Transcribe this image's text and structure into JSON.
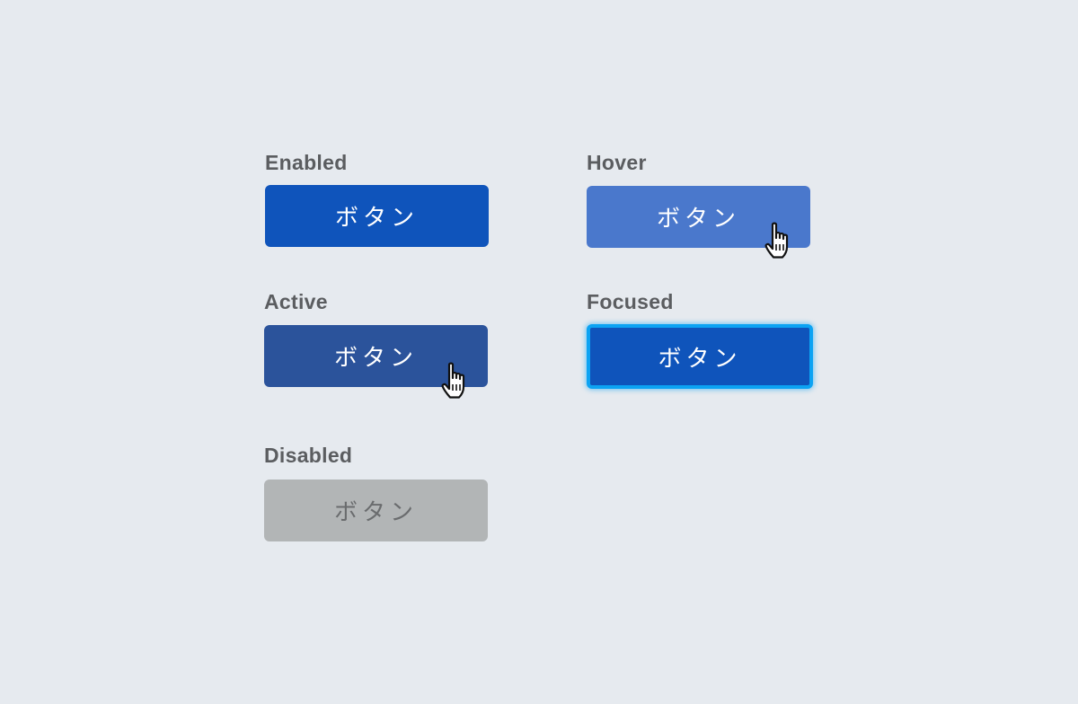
{
  "states": {
    "enabled": {
      "label": "Enabled",
      "button_text": "ボタン"
    },
    "hover": {
      "label": "Hover",
      "button_text": "ボタン"
    },
    "active": {
      "label": "Active",
      "button_text": "ボタン"
    },
    "focused": {
      "label": "Focused",
      "button_text": "ボタン"
    },
    "disabled": {
      "label": "Disabled",
      "button_text": "ボタン"
    }
  },
  "colors": {
    "background": "#e6eaef",
    "enabled": "#0f54bb",
    "hover": "#4a78cc",
    "active": "#2b539b",
    "focused": "#0f54bb",
    "focus_ring": "#0ca3f3",
    "disabled": "#b2b5b6",
    "label_text": "#5b5d60"
  },
  "icons": {
    "pointer": "hand-pointer-icon"
  }
}
